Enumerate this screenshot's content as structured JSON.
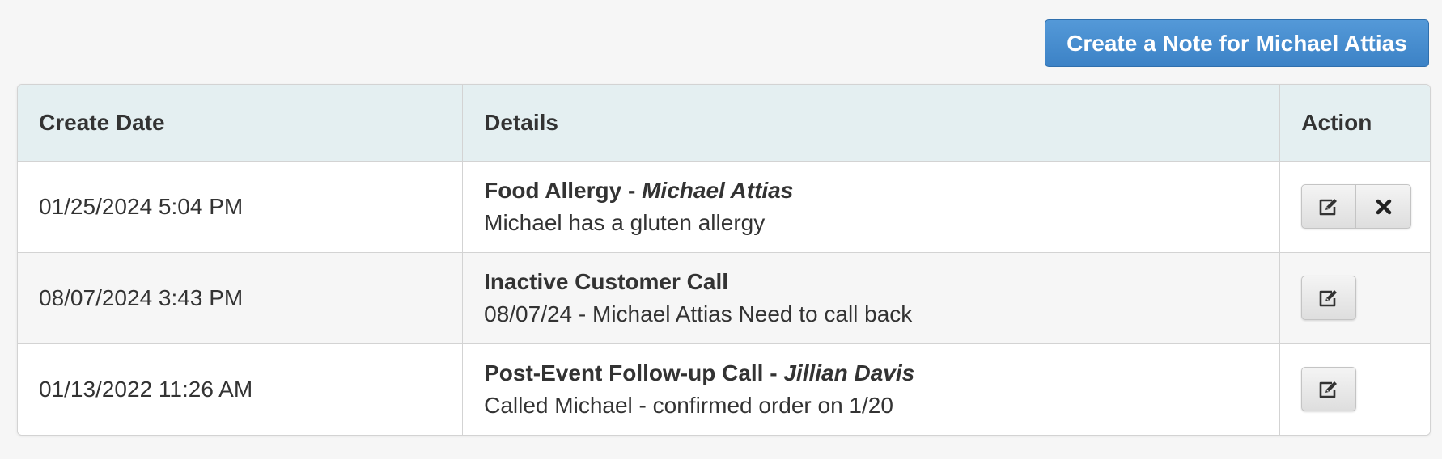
{
  "header": {
    "create_button_label": "Create a Note for Michael Attias"
  },
  "table": {
    "columns": {
      "create_date": "Create Date",
      "details": "Details",
      "action": "Action"
    },
    "rows": [
      {
        "date": "01/25/2024 5:04 PM",
        "title": "Food Allergy",
        "separator": " - ",
        "author": "Michael Attias",
        "body": "Michael has a gluten allergy",
        "actions": [
          "edit-icon",
          "delete-icon"
        ]
      },
      {
        "date": "08/07/2024 3:43 PM",
        "title": "Inactive Customer Call",
        "separator": "",
        "author": "",
        "body": "08/07/24 - Michael Attias Need to call back",
        "actions": [
          "edit-icon"
        ]
      },
      {
        "date": "01/13/2022 11:26 AM",
        "title": "Post-Event Follow-up Call",
        "separator": " - ",
        "author": "Jillian Davis",
        "body": "Called Michael - confirmed order on 1/20",
        "actions": [
          "edit-icon"
        ]
      }
    ]
  },
  "colors": {
    "primary_button": "#4289cf",
    "table_header_bg": "#e4eff1",
    "page_bg": "#f6f6f6",
    "text": "#333333"
  }
}
